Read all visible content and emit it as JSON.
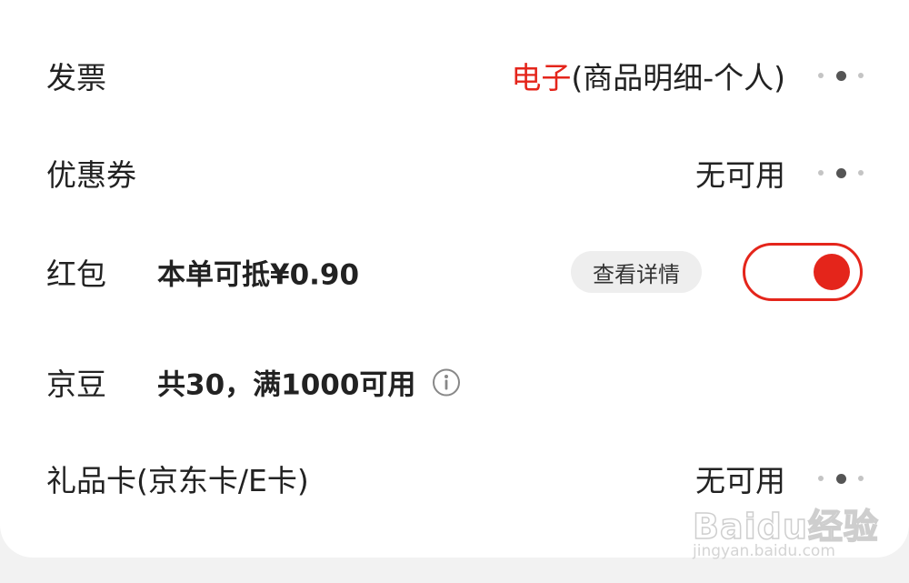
{
  "invoice": {
    "label": "发票",
    "value_accent": "电子",
    "value_rest": "(商品明细-个人)"
  },
  "coupon": {
    "label": "优惠券",
    "value": "无可用"
  },
  "red_packet": {
    "label": "红包",
    "deduct_text": "本单可抵¥0.90",
    "details_button": "查看详情",
    "enabled": true
  },
  "jingdou": {
    "label": "京豆",
    "info_text": "共30，满1000可用",
    "info_icon": "info-icon"
  },
  "gift_card": {
    "label": "礼品卡(京东卡/E卡)",
    "value": "无可用"
  },
  "watermark": {
    "logo": "Baidu经验",
    "url": "jingyan.baidu.com"
  },
  "colors": {
    "accent": "#e4251b",
    "text": "#222222",
    "chip_bg": "#eeeeee",
    "page_bg": "#f2f2f2"
  }
}
